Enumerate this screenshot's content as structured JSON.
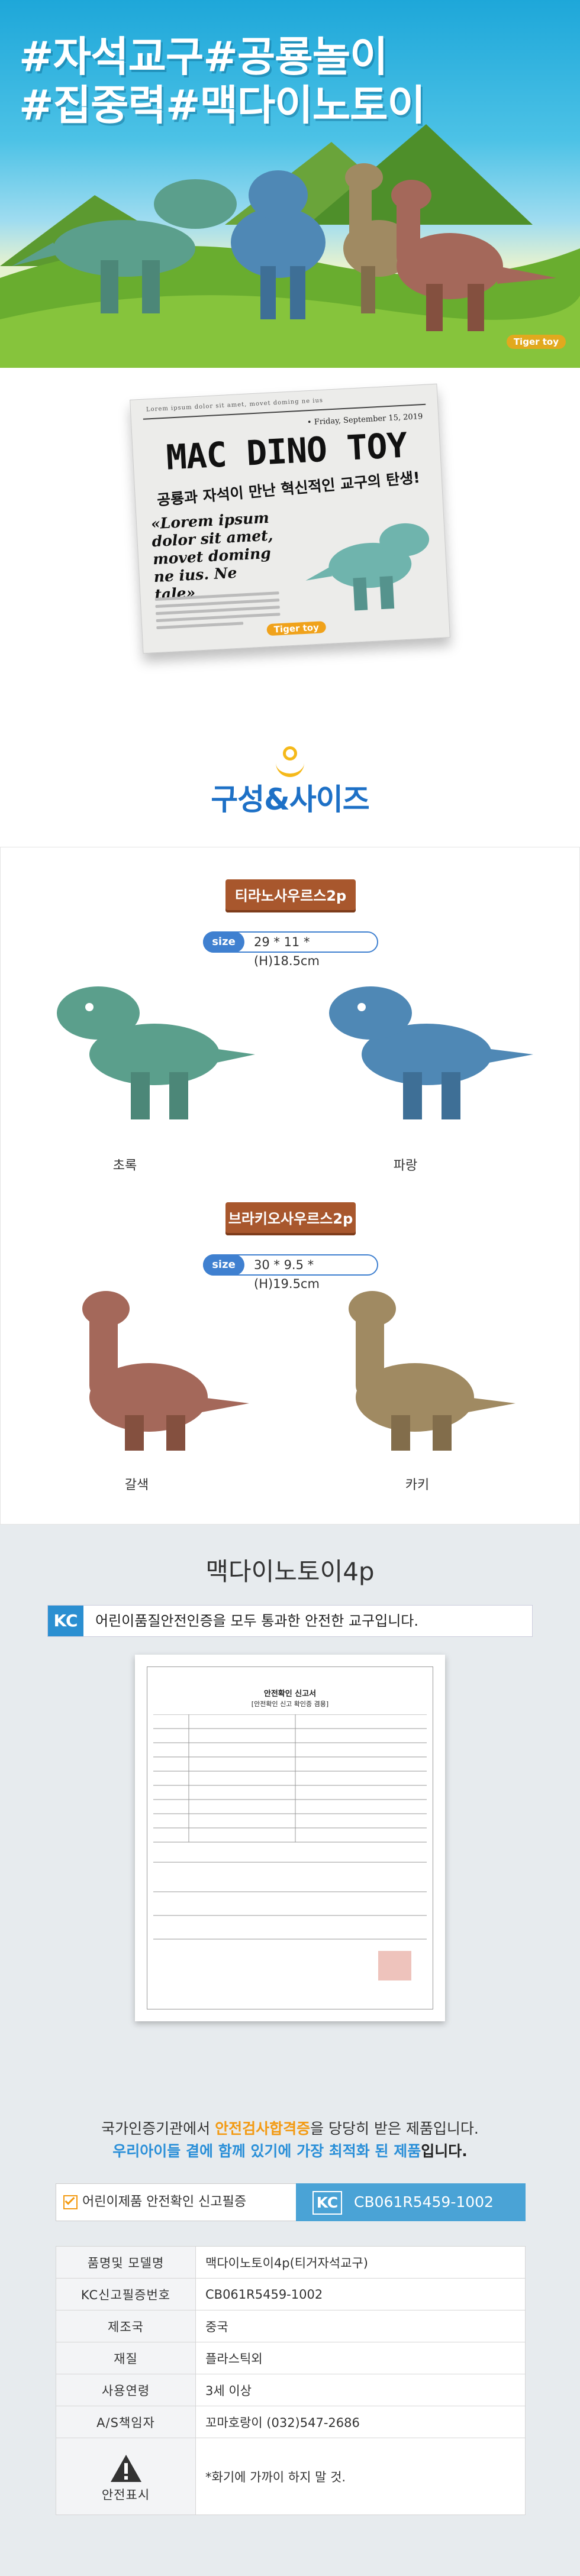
{
  "hero": {
    "line1": "#자석교구#공룡놀이",
    "line2": "#집중력#맥다이노토이",
    "brand": "Tiger toy"
  },
  "newspaper": {
    "masthead_small": "Lorem ipsum dolor sit amet, movet doming ne ius",
    "date": "• Friday, September 15, 2019",
    "title": "MAC DINO TOY",
    "subtitle": "공룡과 자석이 만난 혁신적인 교구의 탄생!",
    "quote": "«Lorem ipsum dolor sit amet, movet doming ne ius. Ne tale»",
    "brand": "Tiger toy"
  },
  "composition": {
    "title": "구성&사이즈"
  },
  "products": [
    {
      "name": "티라노사우르스2p",
      "size_label": "size",
      "size_value": "29 * 11 * (H)18.5cm",
      "variants": [
        "초록",
        "파랑"
      ],
      "colors": [
        "#5b9f8c",
        "#4f88b5"
      ]
    },
    {
      "name": "브라키오사우르스2p",
      "size_label": "size",
      "size_value": "30 * 9.5 * (H)19.5cm",
      "variants": [
        "갈색",
        "카키"
      ],
      "colors": [
        "#a4685a",
        "#a08a62"
      ]
    }
  ],
  "info": {
    "heading": "맥다이노토이4p",
    "kc_icon": "KC",
    "kc_text": "어린이품질안전인증을 모두 통과한 안전한 교구입니다.",
    "notice_line1_a": "국가인증기관에서 ",
    "notice_line1_b": "안전검사합격증",
    "notice_line1_c": "을 당당히 받은 제품입니다.",
    "notice_line2_a": "우리아이들 곁에 함께 있기에 가장 최적화 된 제품",
    "notice_line2_b": "입니다.",
    "badge_left": "어린이제품 안전확인 신고필증",
    "badge_right_icon": "KC",
    "badge_right": "CB061R5459-1002",
    "table": [
      {
        "k": "품명및 모델명",
        "v": "맥다이노토이4p(티거자석교구)"
      },
      {
        "k": "KC신고필증번호",
        "v": "CB061R5459-1002"
      },
      {
        "k": "제조국",
        "v": "중국"
      },
      {
        "k": "재질",
        "v": "플라스틱외"
      },
      {
        "k": "사용연령",
        "v": "3세 이상"
      },
      {
        "k": "A/S책임자",
        "v": "꼬마호랑이 (032)547-2686"
      },
      {
        "k": "안전표시",
        "v": "*화기에 가까이 하지 말 것."
      }
    ],
    "warning_icon": "warning-triangle-icon"
  },
  "certificate": {
    "title": "안전확인 신고서",
    "subtitle": "[안전확인 신고 확인증 겸용]"
  }
}
